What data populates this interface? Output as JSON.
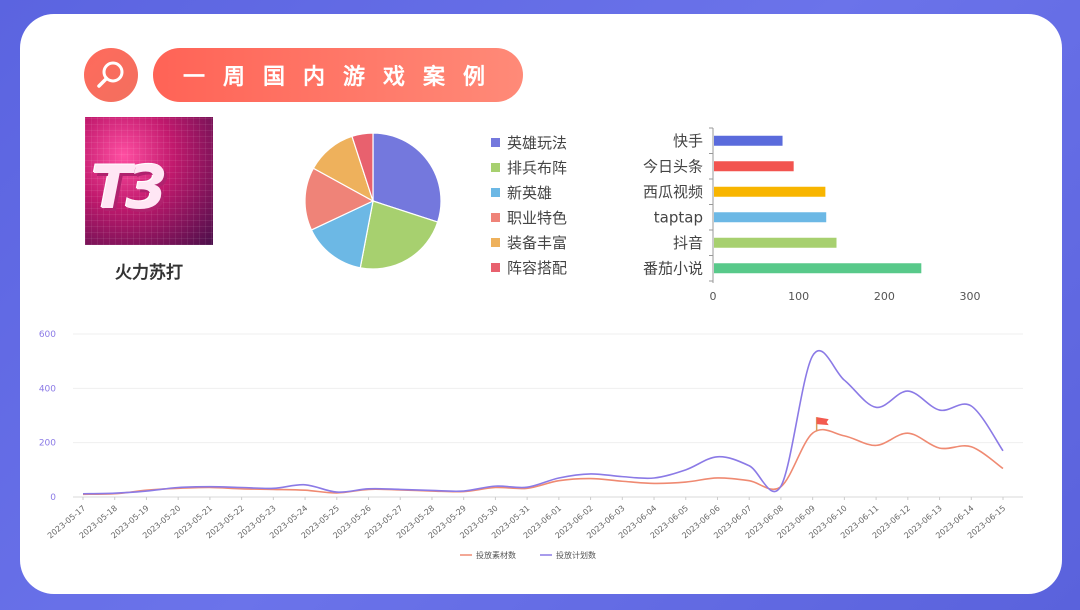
{
  "header": {
    "title": "一周国内游戏案例"
  },
  "game": {
    "logo_text": "T3",
    "name": "火力苏打"
  },
  "colors": {
    "accent": "#ff6a5c",
    "background": "#5b64e0"
  },
  "chart_data": [
    {
      "type": "pie",
      "legend_position": "right",
      "categories": [
        "英雄玩法",
        "排兵布阵",
        "新英雄",
        "职业特色",
        "装备丰富",
        "阵容搭配"
      ],
      "values": [
        30,
        23,
        15,
        15,
        12,
        5
      ],
      "colors": [
        "#7478dd",
        "#a7d06f",
        "#6cb8e5",
        "#ef8378",
        "#eeb15c",
        "#e8616e"
      ]
    },
    {
      "type": "bar",
      "orientation": "horizontal",
      "categories": [
        "快手",
        "今日头条",
        "西瓜视频",
        "taptap",
        "抖音",
        "番茄小说"
      ],
      "values": [
        80,
        93,
        130,
        131,
        143,
        242
      ],
      "colors": [
        "#5a6bdc",
        "#f2544f",
        "#f8b500",
        "#6cb8e5",
        "#a7d06f",
        "#58c98a"
      ],
      "xlim": [
        0,
        300
      ],
      "xticks": [
        "0",
        "100",
        "200",
        "300"
      ],
      "grid": false
    },
    {
      "type": "line",
      "x": [
        "2023-05-17",
        "2023-05-18",
        "2023-05-19",
        "2023-05-20",
        "2023-05-21",
        "2023-05-22",
        "2023-05-23",
        "2023-05-24",
        "2023-05-25",
        "2023-05-26",
        "2023-05-27",
        "2023-05-28",
        "2023-05-29",
        "2023-05-30",
        "2023-05-31",
        "2023-06-01",
        "2023-06-02",
        "2023-06-03",
        "2023-06-04",
        "2023-06-05",
        "2023-06-06",
        "2023-06-07",
        "2023-06-08",
        "2023-06-09",
        "2023-06-10",
        "2023-06-11",
        "2023-06-12",
        "2023-06-13",
        "2023-06-14",
        "2023-06-15"
      ],
      "ylim": [
        0,
        600
      ],
      "yticks": [
        "0",
        "200",
        "400",
        "600"
      ],
      "grid": true,
      "legend_position": "bottom",
      "series": [
        {
          "name": "投放素材数",
          "color": "#ef8a72",
          "values": [
            10,
            12,
            25,
            32,
            35,
            30,
            28,
            25,
            15,
            28,
            26,
            22,
            20,
            35,
            32,
            60,
            68,
            58,
            50,
            55,
            70,
            60,
            38,
            235,
            225,
            190,
            235,
            180,
            185,
            105
          ]
        },
        {
          "name": "投放计划数",
          "color": "#8b7ae6",
          "values": [
            12,
            14,
            22,
            35,
            38,
            35,
            32,
            45,
            18,
            30,
            28,
            24,
            22,
            40,
            36,
            70,
            85,
            75,
            70,
            100,
            148,
            115,
            40,
            520,
            430,
            330,
            390,
            320,
            335,
            170
          ]
        }
      ],
      "flag_color": "#f35a4f"
    }
  ]
}
